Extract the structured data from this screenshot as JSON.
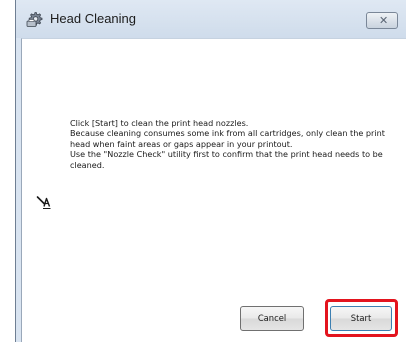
{
  "window": {
    "title": "Head Cleaning",
    "close_glyph": "✕"
  },
  "message": {
    "line1": "Click [Start] to clean the print head nozzles.",
    "line2": "Because cleaning consumes some ink from all cartridges, only clean the print head when faint areas or gaps appear in your printout.",
    "line3": "Use the \"Nozzle Check\" utility first to confirm that the print head needs to be cleaned."
  },
  "buttons": {
    "cancel_label": "Cancel",
    "start_label": "Start"
  },
  "icons": {
    "title_icon": "printer-gear-icon",
    "message_icon": "head-cleaning-icon",
    "close_icon": "close-icon"
  },
  "colors": {
    "highlight": "#e3141e",
    "titlebar": "#d9e4f1"
  }
}
